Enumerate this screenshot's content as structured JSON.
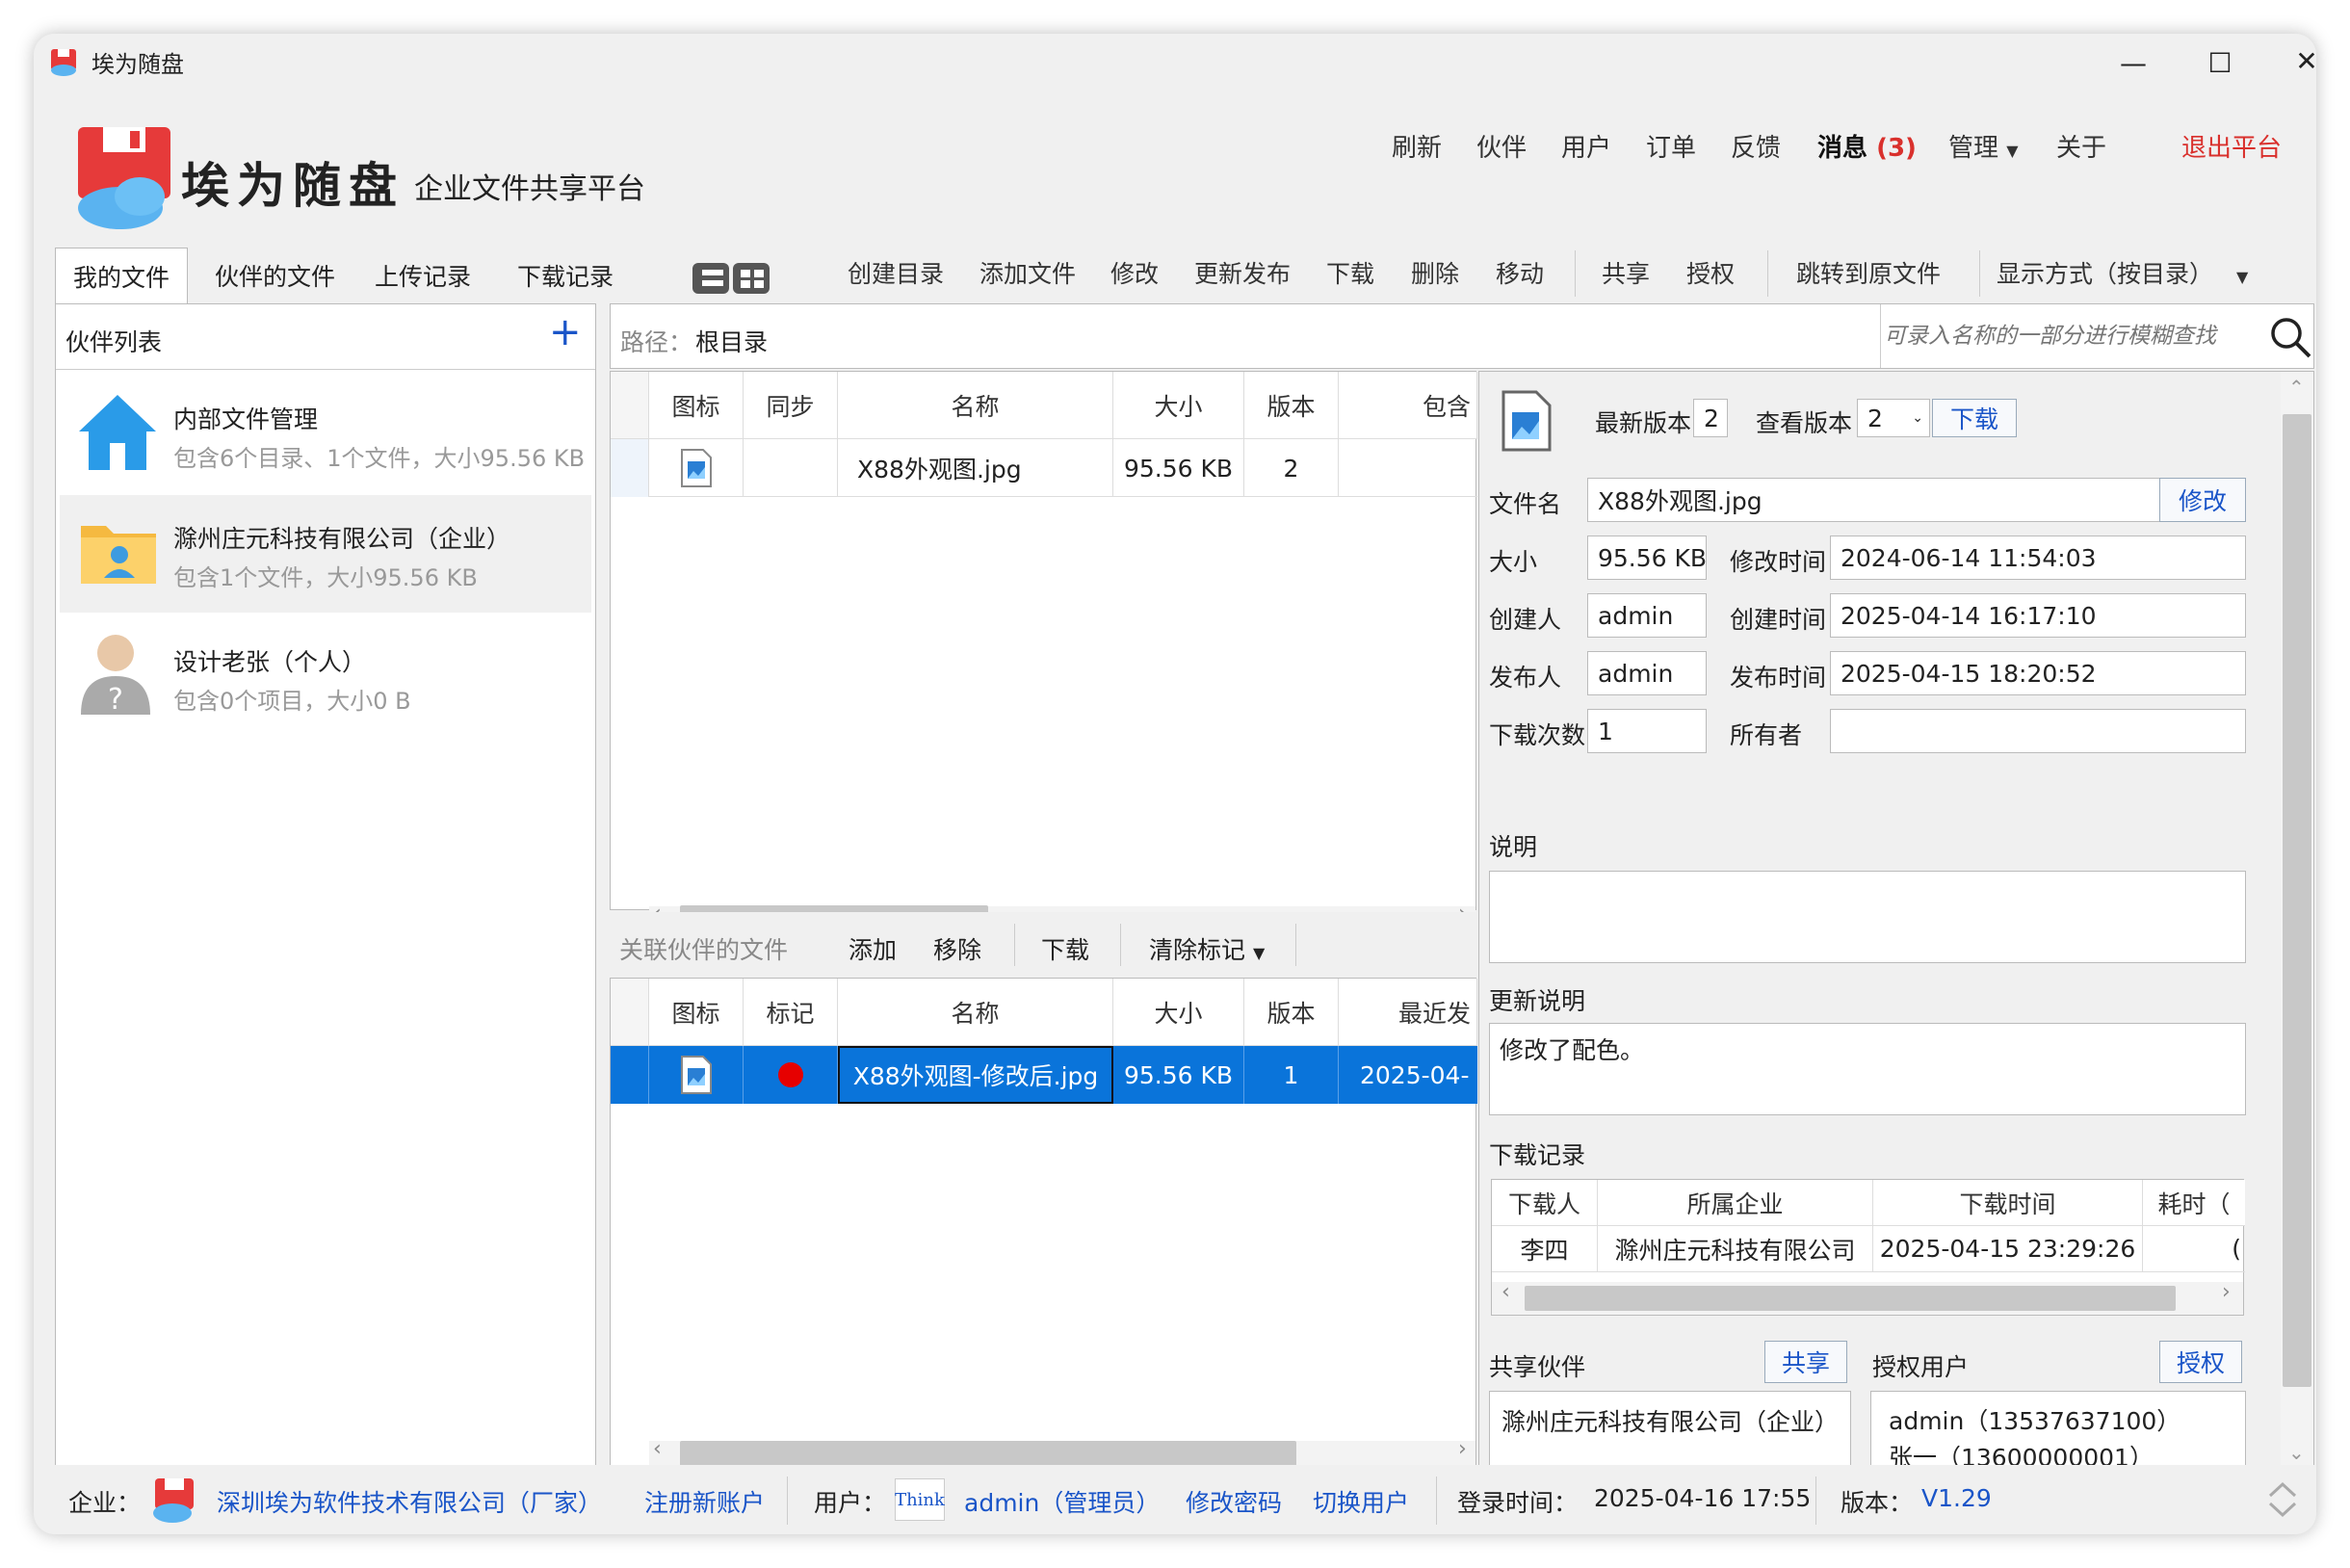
{
  "window": {
    "title": "埃为随盘",
    "minimize": "—",
    "maximize": "☐",
    "close": "✕"
  },
  "brand": {
    "name": "埃为随盘",
    "subtitle": "企业文件共享平台"
  },
  "topnav": {
    "items": [
      "刷新",
      "伙伴",
      "用户",
      "订单",
      "反馈"
    ],
    "message": "消息",
    "message_count": "(3)",
    "manage": "管理",
    "about": "关于",
    "logout": "退出平台"
  },
  "tabs": [
    "我的文件",
    "伙伴的文件",
    "上传记录",
    "下载记录"
  ],
  "toolbar": [
    "创建目录",
    "添加文件",
    "修改",
    "更新发布",
    "下载",
    "删除",
    "移动",
    "共享",
    "授权",
    "跳转到原文件",
    "显示方式（按目录）"
  ],
  "partners": {
    "title": "伙伴列表",
    "add": "+",
    "items": [
      {
        "name": "内部文件管理",
        "desc": "包含6个目录、1个文件，大小95.56 KB",
        "icon": "home-icon"
      },
      {
        "name": "滁州庄元科技有限公司（企业）",
        "desc": "包含1个文件，大小95.56 KB",
        "icon": "folder-user-icon"
      },
      {
        "name": "设计老张（个人）",
        "desc": "包含0个项目，大小0 B",
        "icon": "unknown-user-icon"
      }
    ]
  },
  "path": {
    "label": "路径：",
    "value": "根目录",
    "search_placeholder": "可录入名称的一部分进行模糊查找"
  },
  "filetable": {
    "headers": [
      "图标",
      "同步",
      "名称",
      "大小",
      "版本",
      "包含"
    ],
    "rows": [
      {
        "name": "X88外观图.jpg",
        "size": "95.56 KB",
        "version": "2"
      }
    ]
  },
  "linked": {
    "title": "关联伙伴的文件",
    "actions": [
      "添加",
      "移除",
      "下载",
      "清除标记"
    ],
    "headers": [
      "图标",
      "标记",
      "名称",
      "大小",
      "版本",
      "最近发"
    ],
    "rows": [
      {
        "name": "X88外观图-修改后.jpg",
        "size": "95.56 KB",
        "version": "1",
        "date": "2025-04-"
      }
    ]
  },
  "details": {
    "latest_version_label": "最新版本",
    "latest_version": "2",
    "view_version_label": "查看版本",
    "view_version": "2",
    "download": "下载",
    "filename_label": "文件名",
    "filename": "X88外观图.jpg",
    "modify": "修改",
    "size_label": "大小",
    "size": "95.56 KB",
    "mtime_label": "修改时间",
    "mtime": "2024-06-14 11:54:03",
    "creator_label": "创建人",
    "creator": "admin",
    "ctime_label": "创建时间",
    "ctime": "2025-04-14 16:17:10",
    "publisher_label": "发布人",
    "publisher": "admin",
    "ptime_label": "发布时间",
    "ptime": "2025-04-15 18:20:52",
    "downloads_label": "下载次数",
    "downloads": "1",
    "owner_label": "所有者",
    "owner": "",
    "desc_label": "说明",
    "desc": "",
    "update_label": "更新说明",
    "update": "修改了配色。",
    "dlrec_label": "下载记录",
    "dl_headers": [
      "下载人",
      "所属企业",
      "下载时间",
      "耗时（"
    ],
    "dl_rows": [
      {
        "user": "李四",
        "company": "滁州庄元科技有限公司",
        "time": "2025-04-15 23:29:26",
        "cost": "("
      }
    ],
    "share_label": "共享伙伴",
    "share_btn": "共享",
    "auth_label": "授权用户",
    "auth_btn": "授权",
    "share_list": [
      "滁州庄元科技有限公司（企业）"
    ],
    "auth_list": [
      "admin（13537637100）",
      "张一（13600000001）"
    ]
  },
  "status": {
    "company_label": "企业：",
    "company": "深圳埃为软件技术有限公司（厂家）",
    "register": "注册新账户",
    "user_label": "用户：",
    "user_badge": "Think",
    "user": "admin（管理员）",
    "change_pwd": "修改密码",
    "switch_user": "切换用户",
    "login_label": "登录时间：",
    "login_time": "2025-04-16 17:55",
    "version_label": "版本：",
    "version": "V1.29"
  },
  "colors": {
    "accent": "#1a55c8",
    "selected": "#0a74da",
    "logout": "#d9302c",
    "logo_red": "#e63a3a"
  }
}
